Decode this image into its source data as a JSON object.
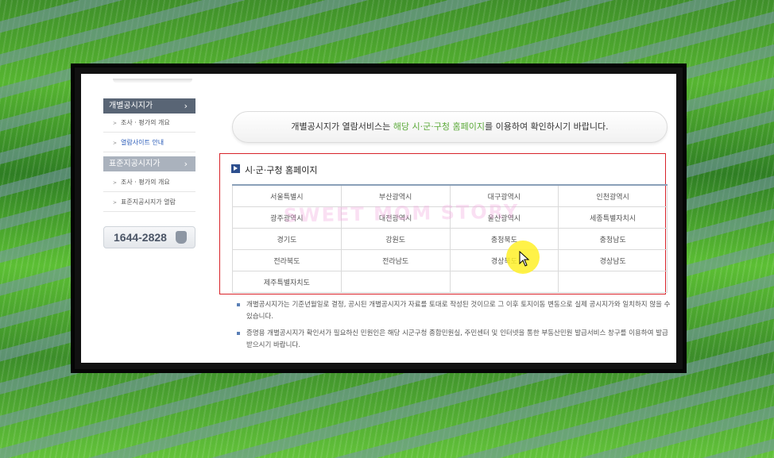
{
  "sidebar": {
    "section1_title": "개별공시지가",
    "section1_items": [
      "조사 · 평가의 개요",
      "열람사이트 안내"
    ],
    "section2_title": "표준지공시지가",
    "section2_items": [
      "조사 · 평가의 개요",
      "표준지공시지가 열람"
    ],
    "phone": "1644-2828"
  },
  "notice": {
    "prefix": "개별공시지가 열람서비스는 ",
    "highlight": "해당 시·군·구청 홈페이지",
    "suffix": "를 이용하여 확인하시기 바랍니다."
  },
  "section_title": "시·군·구청 홈페이지",
  "regions": [
    [
      "서울특별시",
      "부산광역시",
      "대구광역시",
      "인천광역시"
    ],
    [
      "광주광역시",
      "대전광역시",
      "울산광역시",
      "세종특별자치시"
    ],
    [
      "경기도",
      "강원도",
      "충청북도",
      "충청남도"
    ],
    [
      "전라북도",
      "전라남도",
      "경상북도",
      "경상남도"
    ],
    [
      "제주특별자치도",
      "",
      "",
      ""
    ]
  ],
  "watermark": "SWEET MOM STORY",
  "notes": [
    "개별공시지가는 기준년월일로 결정, 공시된 개별공시지가 자료를 토대로 작성된 것이므로 그 이후 토지이동 변동으로 실제 공시지가와 일치하지 않을 수 있습니다.",
    "증명용 개별공시지가 확인서가 필요하신 민원인은 해당 시군구청 종합민원실, 주민센터 및 인터넷을 통한 부동산민원 발급서비스 창구를 이용하여 발급 받으시기 바랍니다."
  ],
  "colors": {
    "highlight_green": "#5caa3a",
    "red_box": "#d8232a",
    "sidebar_dark": "#596575",
    "active_link": "#2a5bb8"
  }
}
